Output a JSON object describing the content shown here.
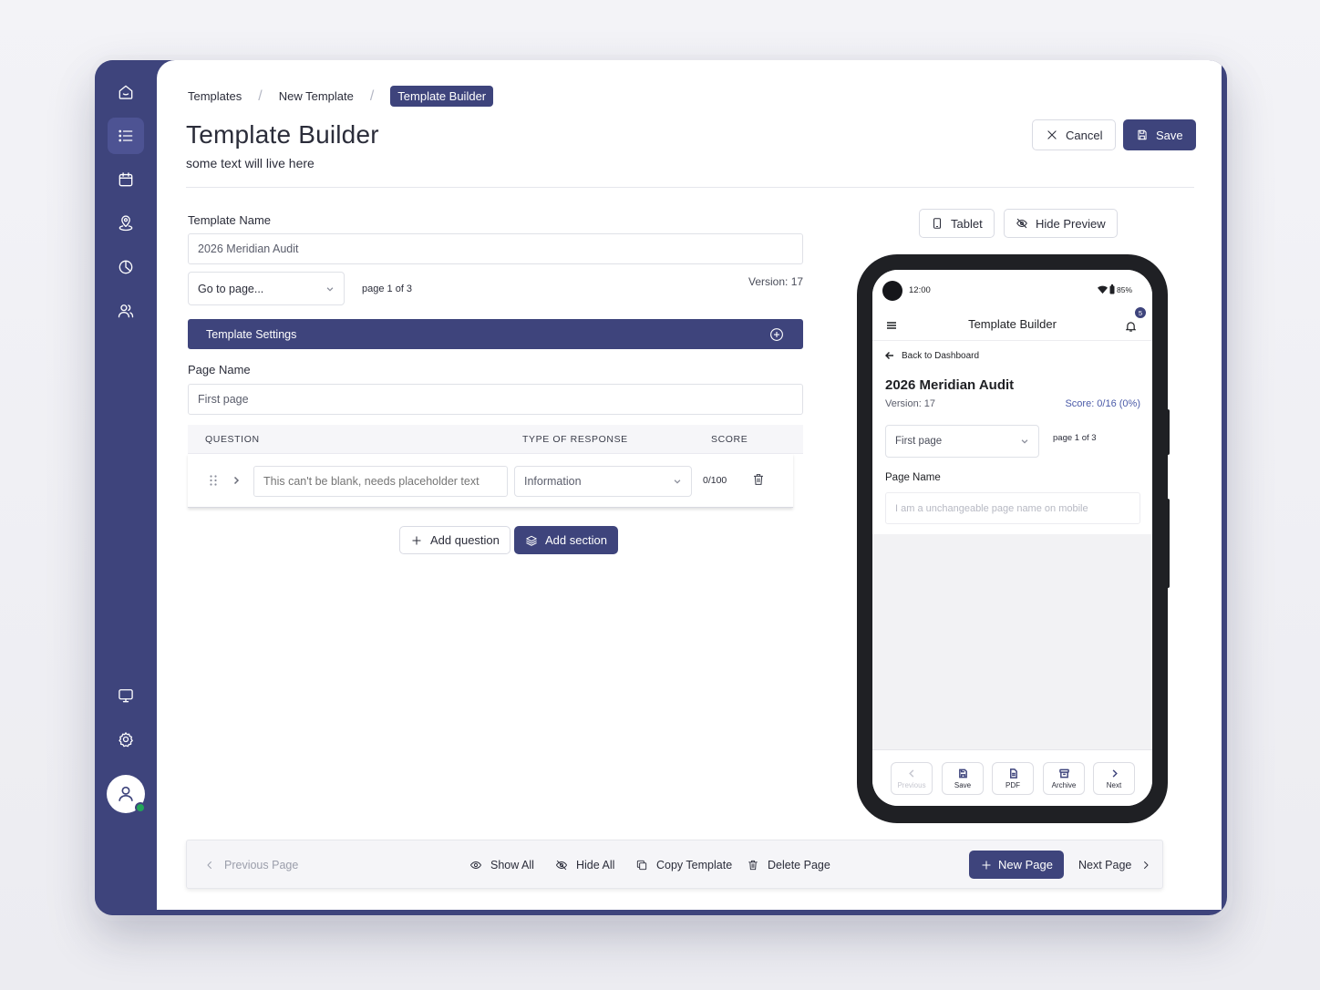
{
  "breadcrumb": {
    "items": [
      "Templates",
      "New Template"
    ],
    "current": "Template Builder",
    "separator": "/"
  },
  "header": {
    "title": "Template Builder",
    "subtitle": "some text will live here",
    "cancel_label": "Cancel",
    "save_label": "Save"
  },
  "form": {
    "template_name_label": "Template Name",
    "template_name_value": "2026 Meridian Audit",
    "goto_page_value": "Go to page...",
    "page_indicator": "page 1 of 3",
    "version": "Version: 17",
    "settings_label": "Template Settings",
    "page_name_label": "Page Name",
    "page_name_value": "First page"
  },
  "table": {
    "columns": [
      "QUESTION",
      "TYPE OF RESPONSE",
      "SCORE"
    ],
    "rows": [
      {
        "question_placeholder": "This can't be blank, needs placeholder text",
        "response_type": "Information",
        "score": "0/100"
      }
    ]
  },
  "actions": {
    "add_question": "Add question",
    "add_section": "Add section"
  },
  "preview": {
    "tablet_label": "Tablet",
    "hide_preview_label": "Hide Preview",
    "mobile": {
      "time": "12:00",
      "battery": "85%",
      "app_title": "Template Builder",
      "notification_count": "5",
      "back_label": "Back to Dashboard",
      "template_title": "2026 Meridian Audit",
      "version": "Version: 17",
      "score": "Score: 0/16 (0%)",
      "page_select": "First page",
      "page_indicator": "page 1 of 3",
      "page_name_label": "Page Name",
      "page_name_placeholder": "I am a unchangeable page name on mobile",
      "footer": [
        "Previous",
        "Save",
        "PDF",
        "Archive",
        "Next"
      ]
    }
  },
  "bottom_bar": {
    "previous_page": "Previous Page",
    "show_all": "Show All",
    "hide_all": "Hide All",
    "copy_template": "Copy Template",
    "delete_page": "Delete Page",
    "new_page": "New Page",
    "next_page": "Next Page"
  },
  "colors": {
    "primary": "#3e447c",
    "online": "#23a559",
    "score_accent": "#4a5aa8"
  }
}
